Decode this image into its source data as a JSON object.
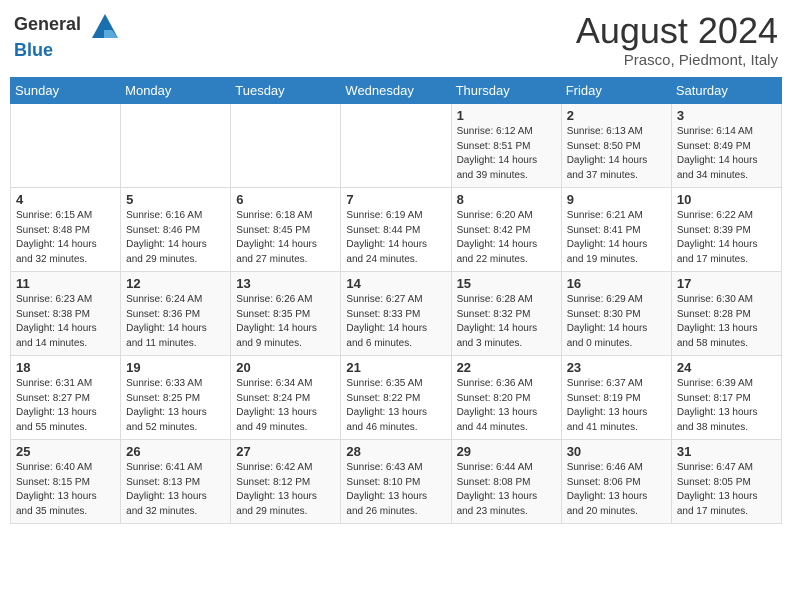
{
  "header": {
    "logo_line1": "General",
    "logo_line2": "Blue",
    "month": "August 2024",
    "location": "Prasco, Piedmont, Italy"
  },
  "days_of_week": [
    "Sunday",
    "Monday",
    "Tuesday",
    "Wednesday",
    "Thursday",
    "Friday",
    "Saturday"
  ],
  "weeks": [
    [
      {
        "date": "",
        "info": ""
      },
      {
        "date": "",
        "info": ""
      },
      {
        "date": "",
        "info": ""
      },
      {
        "date": "",
        "info": ""
      },
      {
        "date": "1",
        "info": "Sunrise: 6:12 AM\nSunset: 8:51 PM\nDaylight: 14 hours\nand 39 minutes."
      },
      {
        "date": "2",
        "info": "Sunrise: 6:13 AM\nSunset: 8:50 PM\nDaylight: 14 hours\nand 37 minutes."
      },
      {
        "date": "3",
        "info": "Sunrise: 6:14 AM\nSunset: 8:49 PM\nDaylight: 14 hours\nand 34 minutes."
      }
    ],
    [
      {
        "date": "4",
        "info": "Sunrise: 6:15 AM\nSunset: 8:48 PM\nDaylight: 14 hours\nand 32 minutes."
      },
      {
        "date": "5",
        "info": "Sunrise: 6:16 AM\nSunset: 8:46 PM\nDaylight: 14 hours\nand 29 minutes."
      },
      {
        "date": "6",
        "info": "Sunrise: 6:18 AM\nSunset: 8:45 PM\nDaylight: 14 hours\nand 27 minutes."
      },
      {
        "date": "7",
        "info": "Sunrise: 6:19 AM\nSunset: 8:44 PM\nDaylight: 14 hours\nand 24 minutes."
      },
      {
        "date": "8",
        "info": "Sunrise: 6:20 AM\nSunset: 8:42 PM\nDaylight: 14 hours\nand 22 minutes."
      },
      {
        "date": "9",
        "info": "Sunrise: 6:21 AM\nSunset: 8:41 PM\nDaylight: 14 hours\nand 19 minutes."
      },
      {
        "date": "10",
        "info": "Sunrise: 6:22 AM\nSunset: 8:39 PM\nDaylight: 14 hours\nand 17 minutes."
      }
    ],
    [
      {
        "date": "11",
        "info": "Sunrise: 6:23 AM\nSunset: 8:38 PM\nDaylight: 14 hours\nand 14 minutes."
      },
      {
        "date": "12",
        "info": "Sunrise: 6:24 AM\nSunset: 8:36 PM\nDaylight: 14 hours\nand 11 minutes."
      },
      {
        "date": "13",
        "info": "Sunrise: 6:26 AM\nSunset: 8:35 PM\nDaylight: 14 hours\nand 9 minutes."
      },
      {
        "date": "14",
        "info": "Sunrise: 6:27 AM\nSunset: 8:33 PM\nDaylight: 14 hours\nand 6 minutes."
      },
      {
        "date": "15",
        "info": "Sunrise: 6:28 AM\nSunset: 8:32 PM\nDaylight: 14 hours\nand 3 minutes."
      },
      {
        "date": "16",
        "info": "Sunrise: 6:29 AM\nSunset: 8:30 PM\nDaylight: 14 hours\nand 0 minutes."
      },
      {
        "date": "17",
        "info": "Sunrise: 6:30 AM\nSunset: 8:28 PM\nDaylight: 13 hours\nand 58 minutes."
      }
    ],
    [
      {
        "date": "18",
        "info": "Sunrise: 6:31 AM\nSunset: 8:27 PM\nDaylight: 13 hours\nand 55 minutes."
      },
      {
        "date": "19",
        "info": "Sunrise: 6:33 AM\nSunset: 8:25 PM\nDaylight: 13 hours\nand 52 minutes."
      },
      {
        "date": "20",
        "info": "Sunrise: 6:34 AM\nSunset: 8:24 PM\nDaylight: 13 hours\nand 49 minutes."
      },
      {
        "date": "21",
        "info": "Sunrise: 6:35 AM\nSunset: 8:22 PM\nDaylight: 13 hours\nand 46 minutes."
      },
      {
        "date": "22",
        "info": "Sunrise: 6:36 AM\nSunset: 8:20 PM\nDaylight: 13 hours\nand 44 minutes."
      },
      {
        "date": "23",
        "info": "Sunrise: 6:37 AM\nSunset: 8:19 PM\nDaylight: 13 hours\nand 41 minutes."
      },
      {
        "date": "24",
        "info": "Sunrise: 6:39 AM\nSunset: 8:17 PM\nDaylight: 13 hours\nand 38 minutes."
      }
    ],
    [
      {
        "date": "25",
        "info": "Sunrise: 6:40 AM\nSunset: 8:15 PM\nDaylight: 13 hours\nand 35 minutes."
      },
      {
        "date": "26",
        "info": "Sunrise: 6:41 AM\nSunset: 8:13 PM\nDaylight: 13 hours\nand 32 minutes."
      },
      {
        "date": "27",
        "info": "Sunrise: 6:42 AM\nSunset: 8:12 PM\nDaylight: 13 hours\nand 29 minutes."
      },
      {
        "date": "28",
        "info": "Sunrise: 6:43 AM\nSunset: 8:10 PM\nDaylight: 13 hours\nand 26 minutes."
      },
      {
        "date": "29",
        "info": "Sunrise: 6:44 AM\nSunset: 8:08 PM\nDaylight: 13 hours\nand 23 minutes."
      },
      {
        "date": "30",
        "info": "Sunrise: 6:46 AM\nSunset: 8:06 PM\nDaylight: 13 hours\nand 20 minutes."
      },
      {
        "date": "31",
        "info": "Sunrise: 6:47 AM\nSunset: 8:05 PM\nDaylight: 13 hours\nand 17 minutes."
      }
    ]
  ]
}
